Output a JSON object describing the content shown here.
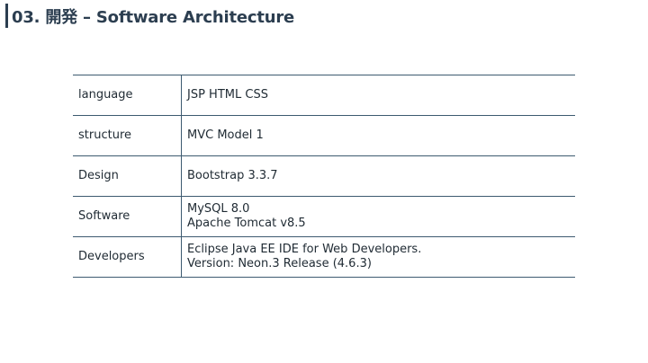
{
  "slide": {
    "title": "03. 開発 – Software Architecture"
  },
  "table": {
    "rows": [
      {
        "key": "language",
        "values": [
          "JSP HTML CSS"
        ]
      },
      {
        "key": "structure",
        "values": [
          "MVC Model 1"
        ]
      },
      {
        "key": "Design",
        "values": [
          "Bootstrap 3.3.7"
        ]
      },
      {
        "key": "Software",
        "values": [
          "MySQL 8.0",
          "Apache Tomcat v8.5"
        ]
      },
      {
        "key": "Developers",
        "values": [
          "Eclipse Java EE IDE for Web Developers.",
          "Version: Neon.3 Release (4.6.3)"
        ]
      }
    ]
  },
  "colors": {
    "title": "#2c3e50",
    "rule": "#3d5a70"
  }
}
